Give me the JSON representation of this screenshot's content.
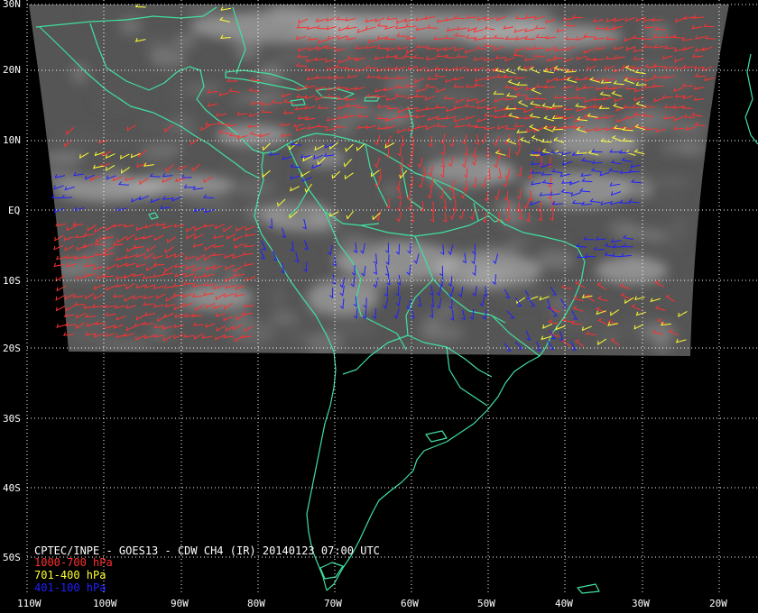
{
  "title": "CPTEC/INPE - GOES13 - CDW CH4 (IR) 20140123 07:00 UTC",
  "lat_labels": [
    "30N",
    "20N",
    "10N",
    "EQ",
    "10S",
    "20S",
    "30S",
    "40S",
    "50S"
  ],
  "lon_labels": [
    "110W",
    "100W",
    "90W",
    "80W",
    "70W",
    "60W",
    "50W",
    "40W",
    "30W",
    "20W"
  ],
  "legend": [
    {
      "label": "1000-700 hPa",
      "color": "#ff3030"
    },
    {
      "label": "701-400 hPa",
      "color": "#ffff30"
    },
    {
      "label": "401-100 hPa",
      "color": "#2020ff"
    }
  ],
  "colors": {
    "background": "#000000",
    "coastline": "#40e0a0",
    "grid": "#ffffff",
    "satellite": "#555555"
  }
}
